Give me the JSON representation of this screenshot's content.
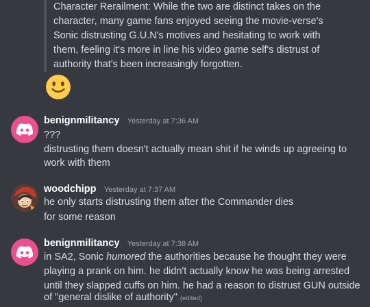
{
  "quote": {
    "text": "Character Rerailment: While the two are distinct takes on the\ncharacter, many game fans enjoyed seeing the movie-verse's\nSonic distrusting G.U.N's motives and hesitating to work with\nthem, feeling it's more in line his video game self's distrust of\nauthority that's been increasingly forgotten."
  },
  "reaction_emoji": "slightly-smiling-face-emoji",
  "messages": [
    {
      "username": "benignmilitancy",
      "timestamp": "Yesterday at 7:36 AM",
      "avatar": "discord-logo-icon",
      "lines": [
        "???",
        "distrusting them doesn't actually mean shit if he winds up agreeing to",
        "work with them"
      ]
    },
    {
      "username": "woodchipp",
      "timestamp": "Yesterday at 7:37 AM",
      "avatar": "character-avatar",
      "lines": [
        "he only starts distrusting them after the Commander dies",
        "for some reason"
      ]
    },
    {
      "username": "benignmilitancy",
      "timestamp": "Yesterday at 7:38 AM",
      "avatar": "discord-logo-icon",
      "lines_parts": {
        "l1_pre": "in SA2, Sonic ",
        "l1_em": "humored",
        "l1_post": " the authorities because he thought they were",
        "l2": "playing a prank on him. he didn't actually know he was being arrested",
        "l3": "until they slapped cuffs on him. he had a reason to distrust GUN outside",
        "l4": "of \"general dislike of authority\"",
        "edited": "(edited)"
      }
    }
  ],
  "colors": {
    "background": "#36393f",
    "discord_avatar": "#ec4f8e",
    "quote_bar": "#4f545c",
    "username": "#ffffff",
    "timestamp": "#a3a6aa",
    "text": "#dcddde"
  }
}
